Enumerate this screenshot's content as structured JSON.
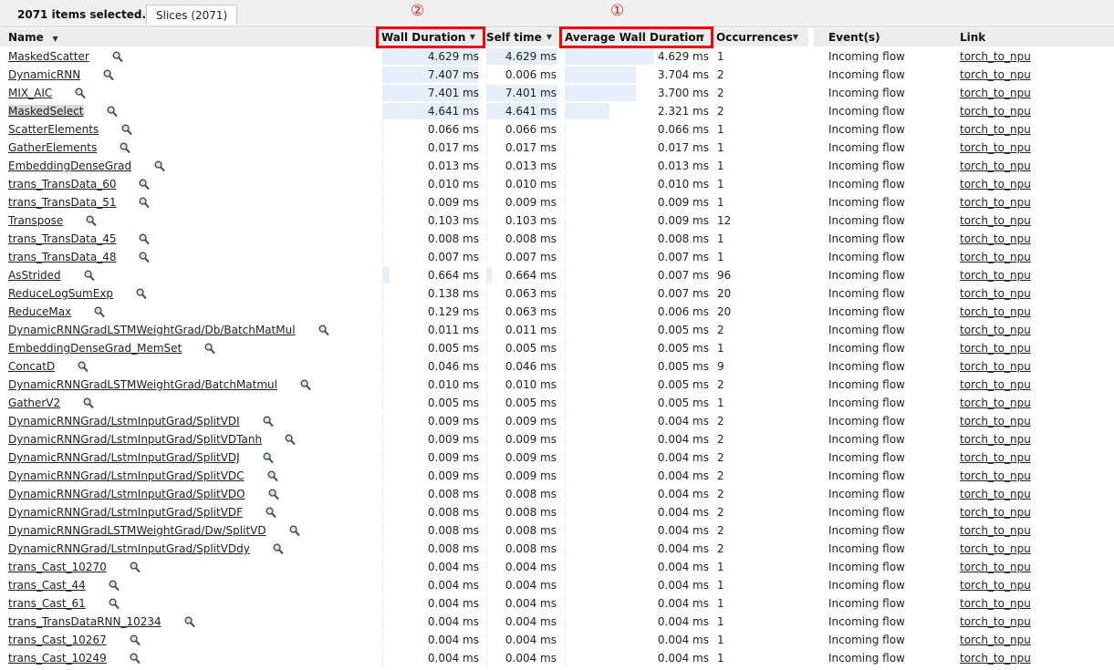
{
  "top": {
    "selected_text": "2071 items selected.",
    "tab_label": "Slices (2071)"
  },
  "annotations": {
    "first": "①",
    "second": "②"
  },
  "headers": {
    "name": "Name",
    "wall": "Wall Duration",
    "self": "Self time",
    "avg": "Average Wall Duration",
    "occ": "Occurrences",
    "events": "Event(s)",
    "link": "Link"
  },
  "rows": [
    {
      "name": "MaskedScatter",
      "wall": "4.629 ms",
      "wall_frac": 1.0,
      "self": "4.629 ms",
      "self_frac": 1.0,
      "avg": "4.629 ms",
      "avg_frac": 1.0,
      "occ": "1",
      "event": "Incoming flow",
      "link": "torch_to_npu"
    },
    {
      "name": "DynamicRNN",
      "wall": "7.407 ms",
      "wall_frac": 1.0,
      "self": "0.006 ms",
      "self_frac": 0.0,
      "avg": "3.704 ms",
      "avg_frac": 0.8,
      "occ": "2",
      "event": "Incoming flow",
      "link": "torch_to_npu"
    },
    {
      "name": "MIX_AIC",
      "wall": "7.401 ms",
      "wall_frac": 1.0,
      "self": "7.401 ms",
      "self_frac": 1.0,
      "avg": "3.700 ms",
      "avg_frac": 0.8,
      "occ": "2",
      "event": "Incoming flow",
      "link": "torch_to_npu"
    },
    {
      "name": "MaskedSelect",
      "wall": "4.641 ms",
      "wall_frac": 1.0,
      "self": "4.641 ms",
      "self_frac": 1.0,
      "avg": "2.321 ms",
      "avg_frac": 0.5,
      "occ": "2",
      "event": "Incoming flow",
      "link": "torch_to_npu",
      "selected": true
    },
    {
      "name": "ScatterElements",
      "wall": "0.066 ms",
      "wall_frac": 0.01,
      "self": "0.066 ms",
      "self_frac": 0.01,
      "avg": "0.066 ms",
      "avg_frac": 0.01,
      "occ": "1",
      "event": "Incoming flow",
      "link": "torch_to_npu"
    },
    {
      "name": "GatherElements",
      "wall": "0.017 ms",
      "wall_frac": 0.005,
      "self": "0.017 ms",
      "self_frac": 0.005,
      "avg": "0.017 ms",
      "avg_frac": 0.005,
      "occ": "1",
      "event": "Incoming flow",
      "link": "torch_to_npu"
    },
    {
      "name": "EmbeddingDenseGrad",
      "wall": "0.013 ms",
      "wall_frac": 0.005,
      "self": "0.013 ms",
      "self_frac": 0.005,
      "avg": "0.013 ms",
      "avg_frac": 0.005,
      "occ": "1",
      "event": "Incoming flow",
      "link": "torch_to_npu"
    },
    {
      "name": "trans_TransData_60",
      "wall": "0.010 ms",
      "wall_frac": 0.005,
      "self": "0.010 ms",
      "self_frac": 0.005,
      "avg": "0.010 ms",
      "avg_frac": 0.005,
      "occ": "1",
      "event": "Incoming flow",
      "link": "torch_to_npu"
    },
    {
      "name": "trans_TransData_51",
      "wall": "0.009 ms",
      "wall_frac": 0.005,
      "self": "0.009 ms",
      "self_frac": 0.005,
      "avg": "0.009 ms",
      "avg_frac": 0.005,
      "occ": "1",
      "event": "Incoming flow",
      "link": "torch_to_npu"
    },
    {
      "name": "Transpose",
      "wall": "0.103 ms",
      "wall_frac": 0.01,
      "self": "0.103 ms",
      "self_frac": 0.01,
      "avg": "0.009 ms",
      "avg_frac": 0.005,
      "occ": "12",
      "event": "Incoming flow",
      "link": "torch_to_npu"
    },
    {
      "name": "trans_TransData_45",
      "wall": "0.008 ms",
      "wall_frac": 0.005,
      "self": "0.008 ms",
      "self_frac": 0.005,
      "avg": "0.008 ms",
      "avg_frac": 0.005,
      "occ": "1",
      "event": "Incoming flow",
      "link": "torch_to_npu"
    },
    {
      "name": "trans_TransData_48",
      "wall": "0.007 ms",
      "wall_frac": 0.005,
      "self": "0.007 ms",
      "self_frac": 0.005,
      "avg": "0.007 ms",
      "avg_frac": 0.005,
      "occ": "1",
      "event": "Incoming flow",
      "link": "torch_to_npu"
    },
    {
      "name": "AsStrided",
      "wall": "0.664 ms",
      "wall_frac": 0.08,
      "self": "0.664 ms",
      "self_frac": 0.08,
      "avg": "0.007 ms",
      "avg_frac": 0.005,
      "occ": "96",
      "event": "Incoming flow",
      "link": "torch_to_npu"
    },
    {
      "name": "ReduceLogSumExp",
      "wall": "0.138 ms",
      "wall_frac": 0.01,
      "self": "0.063 ms",
      "self_frac": 0.005,
      "avg": "0.007 ms",
      "avg_frac": 0.005,
      "occ": "20",
      "event": "Incoming flow",
      "link": "torch_to_npu"
    },
    {
      "name": "ReduceMax",
      "wall": "0.129 ms",
      "wall_frac": 0.01,
      "self": "0.063 ms",
      "self_frac": 0.005,
      "avg": "0.006 ms",
      "avg_frac": 0.005,
      "occ": "20",
      "event": "Incoming flow",
      "link": "torch_to_npu"
    },
    {
      "name": "DynamicRNNGradLSTMWeightGrad/Db/BatchMatMul",
      "wall": "0.011 ms",
      "wall_frac": 0.005,
      "self": "0.011 ms",
      "self_frac": 0.005,
      "avg": "0.005 ms",
      "avg_frac": 0.005,
      "occ": "2",
      "event": "Incoming flow",
      "link": "torch_to_npu"
    },
    {
      "name": "EmbeddingDenseGrad_MemSet",
      "wall": "0.005 ms",
      "wall_frac": 0.005,
      "self": "0.005 ms",
      "self_frac": 0.005,
      "avg": "0.005 ms",
      "avg_frac": 0.005,
      "occ": "1",
      "event": "Incoming flow",
      "link": "torch_to_npu"
    },
    {
      "name": "ConcatD",
      "wall": "0.046 ms",
      "wall_frac": 0.005,
      "self": "0.046 ms",
      "self_frac": 0.005,
      "avg": "0.005 ms",
      "avg_frac": 0.005,
      "occ": "9",
      "event": "Incoming flow",
      "link": "torch_to_npu"
    },
    {
      "name": "DynamicRNNGradLSTMWeightGrad/BatchMatmul",
      "wall": "0.010 ms",
      "wall_frac": 0.005,
      "self": "0.010 ms",
      "self_frac": 0.005,
      "avg": "0.005 ms",
      "avg_frac": 0.005,
      "occ": "2",
      "event": "Incoming flow",
      "link": "torch_to_npu"
    },
    {
      "name": "GatherV2",
      "wall": "0.005 ms",
      "wall_frac": 0.005,
      "self": "0.005 ms",
      "self_frac": 0.005,
      "avg": "0.005 ms",
      "avg_frac": 0.005,
      "occ": "1",
      "event": "Incoming flow",
      "link": "torch_to_npu"
    },
    {
      "name": "DynamicRNNGrad/LstmInputGrad/SplitVDI",
      "wall": "0.009 ms",
      "wall_frac": 0.005,
      "self": "0.009 ms",
      "self_frac": 0.005,
      "avg": "0.004 ms",
      "avg_frac": 0.005,
      "occ": "2",
      "event": "Incoming flow",
      "link": "torch_to_npu"
    },
    {
      "name": "DynamicRNNGrad/LstmInputGrad/SplitVDTanh",
      "wall": "0.009 ms",
      "wall_frac": 0.005,
      "self": "0.009 ms",
      "self_frac": 0.005,
      "avg": "0.004 ms",
      "avg_frac": 0.005,
      "occ": "2",
      "event": "Incoming flow",
      "link": "torch_to_npu"
    },
    {
      "name": "DynamicRNNGrad/LstmInputGrad/SplitVDJ",
      "wall": "0.009 ms",
      "wall_frac": 0.005,
      "self": "0.009 ms",
      "self_frac": 0.005,
      "avg": "0.004 ms",
      "avg_frac": 0.005,
      "occ": "2",
      "event": "Incoming flow",
      "link": "torch_to_npu"
    },
    {
      "name": "DynamicRNNGrad/LstmInputGrad/SplitVDC",
      "wall": "0.009 ms",
      "wall_frac": 0.005,
      "self": "0.009 ms",
      "self_frac": 0.005,
      "avg": "0.004 ms",
      "avg_frac": 0.005,
      "occ": "2",
      "event": "Incoming flow",
      "link": "torch_to_npu"
    },
    {
      "name": "DynamicRNNGrad/LstmInputGrad/SplitVDO",
      "wall": "0.008 ms",
      "wall_frac": 0.005,
      "self": "0.008 ms",
      "self_frac": 0.005,
      "avg": "0.004 ms",
      "avg_frac": 0.005,
      "occ": "2",
      "event": "Incoming flow",
      "link": "torch_to_npu"
    },
    {
      "name": "DynamicRNNGrad/LstmInputGrad/SplitVDF",
      "wall": "0.008 ms",
      "wall_frac": 0.005,
      "self": "0.008 ms",
      "self_frac": 0.005,
      "avg": "0.004 ms",
      "avg_frac": 0.005,
      "occ": "2",
      "event": "Incoming flow",
      "link": "torch_to_npu"
    },
    {
      "name": "DynamicRNNGradLSTMWeightGrad/Dw/SplitVD",
      "wall": "0.008 ms",
      "wall_frac": 0.005,
      "self": "0.008 ms",
      "self_frac": 0.005,
      "avg": "0.004 ms",
      "avg_frac": 0.005,
      "occ": "2",
      "event": "Incoming flow",
      "link": "torch_to_npu"
    },
    {
      "name": "DynamicRNNGrad/LstmInputGrad/SplitVDdy",
      "wall": "0.008 ms",
      "wall_frac": 0.005,
      "self": "0.008 ms",
      "self_frac": 0.005,
      "avg": "0.004 ms",
      "avg_frac": 0.005,
      "occ": "2",
      "event": "Incoming flow",
      "link": "torch_to_npu"
    },
    {
      "name": "trans_Cast_10270",
      "wall": "0.004 ms",
      "wall_frac": 0.005,
      "self": "0.004 ms",
      "self_frac": 0.005,
      "avg": "0.004 ms",
      "avg_frac": 0.005,
      "occ": "1",
      "event": "Incoming flow",
      "link": "torch_to_npu"
    },
    {
      "name": "trans_Cast_44",
      "wall": "0.004 ms",
      "wall_frac": 0.005,
      "self": "0.004 ms",
      "self_frac": 0.005,
      "avg": "0.004 ms",
      "avg_frac": 0.005,
      "occ": "1",
      "event": "Incoming flow",
      "link": "torch_to_npu"
    },
    {
      "name": "trans_Cast_61",
      "wall": "0.004 ms",
      "wall_frac": 0.005,
      "self": "0.004 ms",
      "self_frac": 0.005,
      "avg": "0.004 ms",
      "avg_frac": 0.005,
      "occ": "1",
      "event": "Incoming flow",
      "link": "torch_to_npu"
    },
    {
      "name": "trans_TransDataRNN_10234",
      "wall": "0.004 ms",
      "wall_frac": 0.005,
      "self": "0.004 ms",
      "self_frac": 0.005,
      "avg": "0.004 ms",
      "avg_frac": 0.005,
      "occ": "1",
      "event": "Incoming flow",
      "link": "torch_to_npu"
    },
    {
      "name": "trans_Cast_10267",
      "wall": "0.004 ms",
      "wall_frac": 0.005,
      "self": "0.004 ms",
      "self_frac": 0.005,
      "avg": "0.004 ms",
      "avg_frac": 0.005,
      "occ": "1",
      "event": "Incoming flow",
      "link": "torch_to_npu"
    },
    {
      "name": "trans_Cast_10249",
      "wall": "0.004 ms",
      "wall_frac": 0.005,
      "self": "0.004 ms",
      "self_frac": 0.005,
      "avg": "0.004 ms",
      "avg_frac": 0.005,
      "occ": "1",
      "event": "Incoming flow",
      "link": "torch_to_npu"
    }
  ],
  "colors": {
    "bar": "#e6eefa",
    "highlight_box": "#ff0000",
    "annotation": "#e02020"
  },
  "icons": {
    "row_search": "magnifier-icon",
    "sort": "sort-arrow-icon"
  }
}
